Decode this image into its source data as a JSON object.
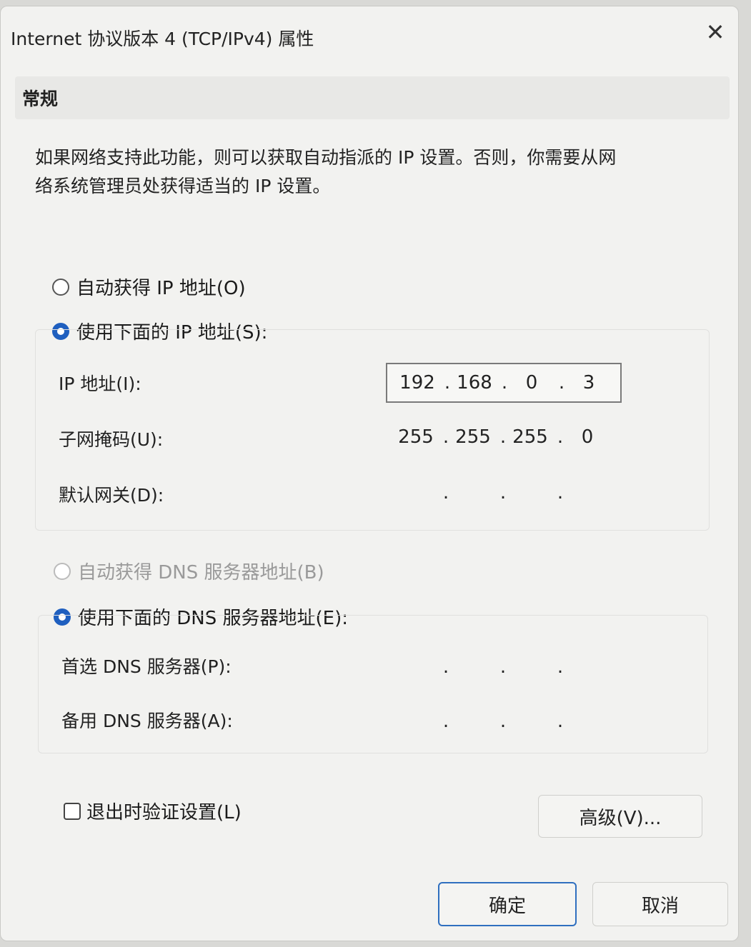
{
  "window": {
    "title": "Internet 协议版本 4 (TCP/IPv4) 属性",
    "close_glyph": "✕"
  },
  "tabs": [
    {
      "label": "常规"
    }
  ],
  "description": {
    "line1": "如果网络支持此功能，则可以获取自动指派的 IP 设置。否则，你需要从网",
    "line2": "络系统管理员处获得适当的 IP 设置。"
  },
  "ip_mode": {
    "auto_label": "自动获得 IP 地址(O)",
    "manual_label": "使用下面的 IP 地址(S):",
    "selected": "manual"
  },
  "ip_fields": {
    "ip_label": "IP 地址(I):",
    "ip_octets": [
      "192",
      "168",
      "0",
      "3"
    ],
    "mask_label": "子网掩码(U):",
    "mask_octets": [
      "255",
      "255",
      "255",
      "0"
    ],
    "gateway_label": "默认网关(D):",
    "gateway_octets": [
      "",
      "",
      "",
      ""
    ]
  },
  "dns_mode": {
    "auto_label": "自动获得 DNS 服务器地址(B)",
    "manual_label": "使用下面的 DNS 服务器地址(E):",
    "selected": "manual"
  },
  "dns_fields": {
    "preferred_label": "首选 DNS 服务器(P):",
    "preferred_octets": [
      "",
      "",
      "",
      ""
    ],
    "alternate_label": "备用 DNS 服务器(A):",
    "alternate_octets": [
      "",
      "",
      "",
      ""
    ]
  },
  "validate": {
    "label": "退出时验证设置(L)",
    "checked": false
  },
  "buttons": {
    "advanced": "高级(V)...",
    "ok": "确定",
    "cancel": "取消"
  },
  "colors": {
    "accent": "#1f5fbf"
  }
}
